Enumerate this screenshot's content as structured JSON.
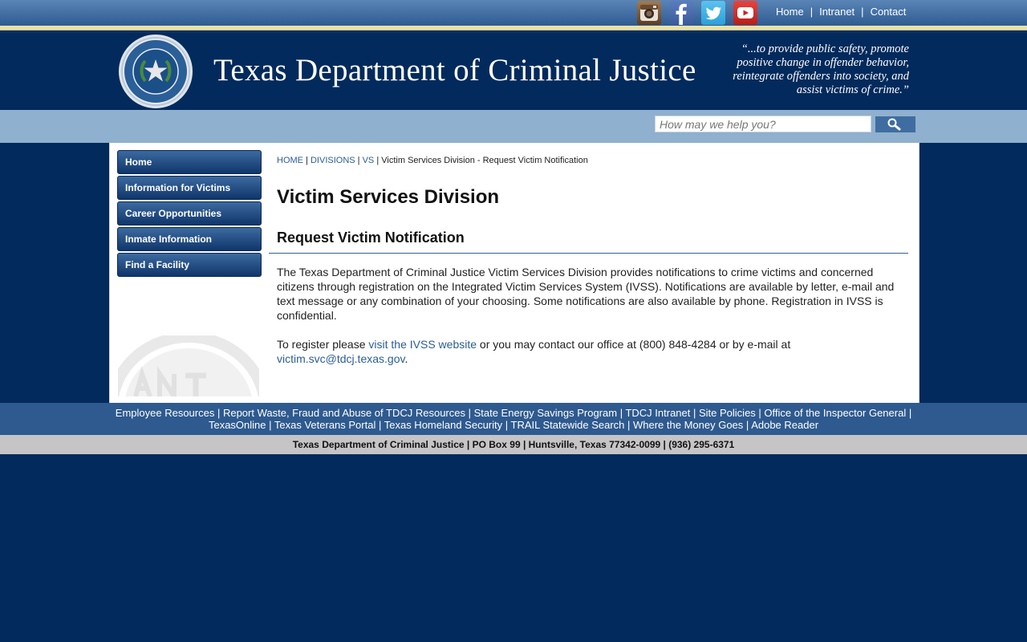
{
  "topnav": {
    "social": [
      "instagram-icon",
      "facebook-icon",
      "twitter-icon",
      "youtube-icon"
    ],
    "links": [
      "Home",
      "Intranet",
      "Contact"
    ],
    "separator": "|"
  },
  "header": {
    "title": "Texas Department of Criminal Justice",
    "motto": "“...to provide public safety, promote positive change in offender behavior, reintegrate offenders into society, and assist victims of crime.”",
    "seal": "tdcj-seal-icon"
  },
  "search": {
    "placeholder": "How may we help you?",
    "button_icon": "search-icon"
  },
  "sidebar": {
    "items": [
      "Home",
      "Information for Victims",
      "Career Opportunities",
      "Inmate Information",
      "Find a Facility"
    ]
  },
  "breadcrumb": {
    "links": [
      "HOME",
      "DIVISIONS",
      "VS"
    ],
    "current": "Victim Services Division - Request Victim Notification",
    "separator": "|"
  },
  "main": {
    "title": "Victim Services Division",
    "subtitle": "Request Victim Notification",
    "paragraph1": "The Texas Department of Criminal Justice Victim Services Division provides notifications to crime victims and concerned citizens through registration on the Integrated Victim Services System (IVSS). Notifications are available by letter, e-mail and text message or any combination of your choosing. Some notifications are also available by phone. Registration in IVSS is confidential.",
    "register_prefix": "To register please ",
    "ivss_link": "visit the IVSS website",
    "register_mid": " or you may contact our office at ",
    "phone": "(800) 848-4284",
    "register_mid2": " or by e-mail at ",
    "email": "victim.svc@tdcj.texas.gov",
    "register_end": "."
  },
  "footer": {
    "links_row1": [
      "Employee Resources",
      "Report Waste, Fraud and Abuse of TDCJ Resources",
      "State Energy Savings Program",
      "TDCJ Intranet",
      "Site Policies",
      "Office of the Inspector General"
    ],
    "links_row2": [
      "TexasOnline",
      "Texas Veterans Portal",
      "Texas Homeland Security",
      "TRAIL Statewide Search",
      "Where the Money Goes",
      "Adobe Reader"
    ],
    "address": "Texas Department of Criminal Justice | PO Box 99 | Huntsville, Texas 77342-0099 | (936) 295-6371"
  },
  "colors": {
    "navy": "#022a5c",
    "blue": "#2e5a8f",
    "light_blue": "#8fb0ce",
    "link": "#2a5d96"
  }
}
